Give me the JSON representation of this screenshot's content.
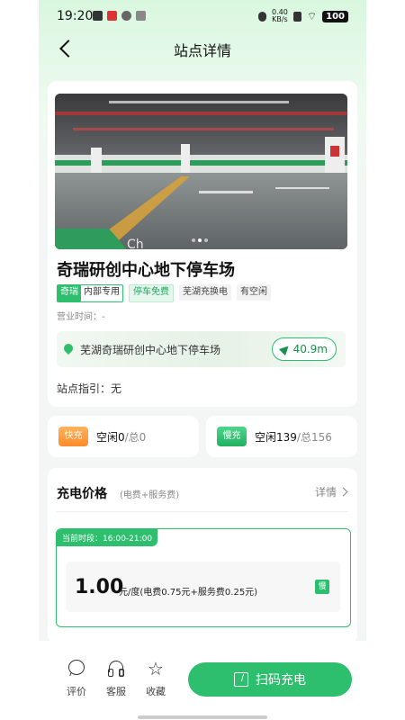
{
  "status_bar": {
    "time": "19:20",
    "net_speed_value": "0.40",
    "net_speed_unit": "KB/s",
    "battery": "100"
  },
  "nav": {
    "title": "站点详情"
  },
  "station": {
    "name": "奇瑞研创中心地下停车场",
    "tags": {
      "brand": "奇瑞",
      "brand_type": "内部专用",
      "free_parking": "停车免费",
      "swap": "芜湖充换电",
      "vacancy": "有空闲"
    },
    "hours_label": "营业时间：-",
    "address": "芜湖奇瑞研创中心地下停车场",
    "distance": "40.9m",
    "guide": "站点指引：无",
    "photo_dots": 3,
    "photo_dot_active": 1
  },
  "fast": {
    "badge": "快充",
    "free_label": "空闲0",
    "total_label": "/总0"
  },
  "slow": {
    "badge": "慢充",
    "free_label": "空闲139",
    "total_label": "/总156"
  },
  "price": {
    "title": "充电价格",
    "subtitle": "(电费+服务费)",
    "more": "详情",
    "period_label": "当前时段：16:00-21:00",
    "amount": "1.00",
    "unit_detail": "元/度(电费0.75元+服务费0.25元)",
    "slow_mark": "慢"
  },
  "bottom": {
    "review": "评价",
    "service": "客服",
    "favorite": "收藏",
    "scan": "扫码充电"
  },
  "colors": {
    "accent": "#2dbf6d",
    "fast": "#ff8a2a",
    "text": "#111111",
    "muted": "#888888"
  },
  "icons": [
    "back-icon",
    "location-pin-icon",
    "navigate-arrow-icon",
    "chevron-right-icon",
    "chat-icon",
    "headset-icon",
    "star-icon",
    "scan-icon"
  ]
}
